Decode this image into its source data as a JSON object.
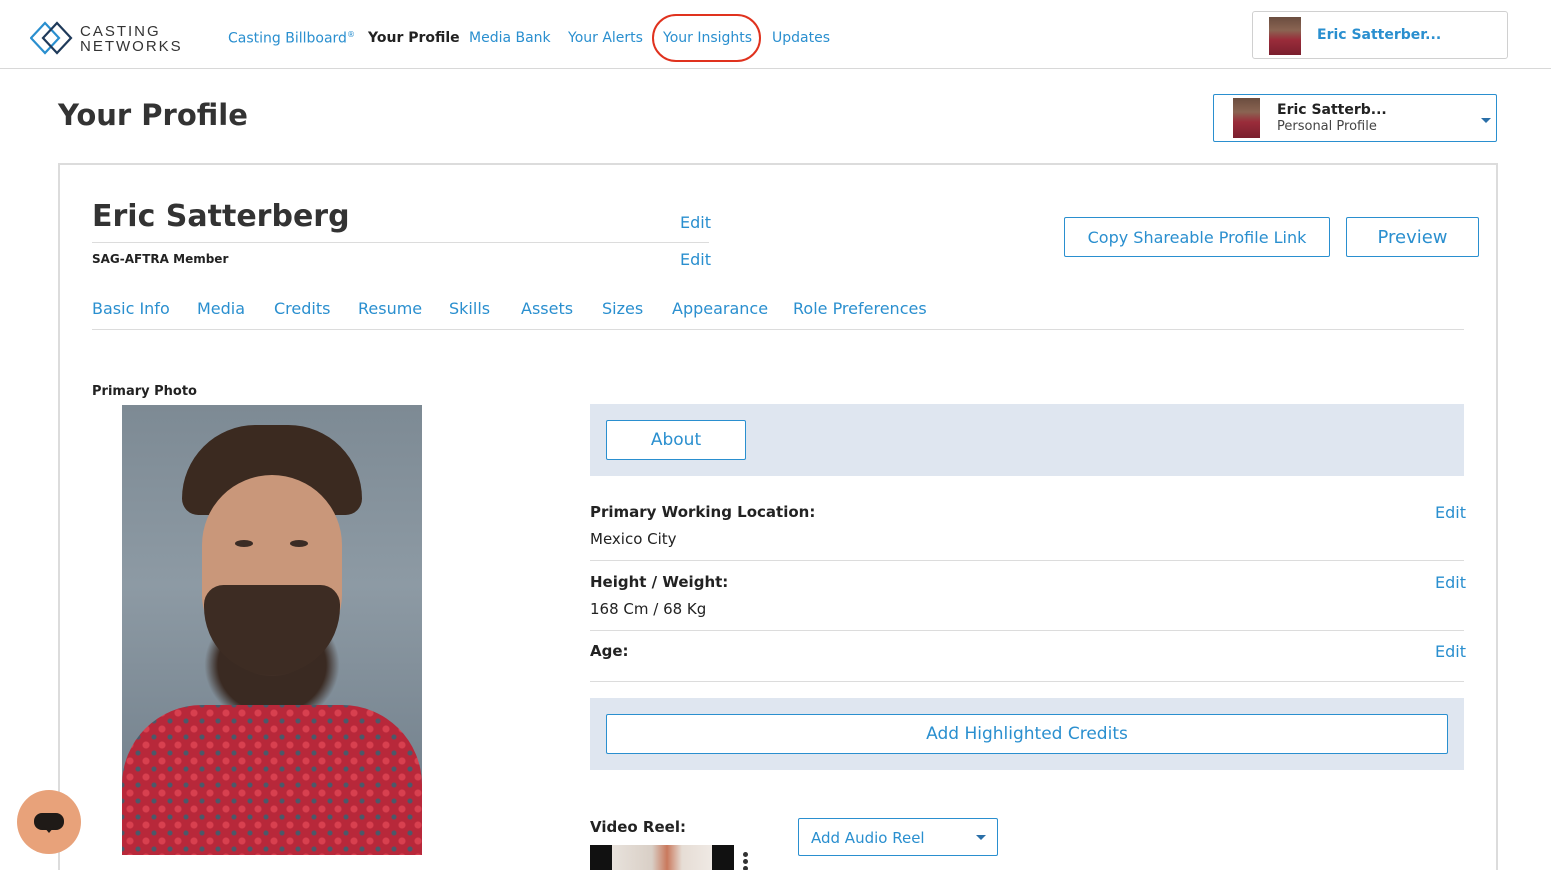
{
  "brand": {
    "line1": "CASTING",
    "line2": "NETWORKS"
  },
  "nav": {
    "items": [
      {
        "label": "Casting Billboard",
        "suffix": "®"
      },
      {
        "label": "Your Profile"
      },
      {
        "label": "Media Bank"
      },
      {
        "label": "Your Alerts"
      },
      {
        "label": "Your Insights"
      },
      {
        "label": "Updates"
      }
    ],
    "active": "Your Profile",
    "highlighted": "Your Insights"
  },
  "account": {
    "name": "Eric Satterber..."
  },
  "page": {
    "title": "Your Profile"
  },
  "profile_selector": {
    "name": "Eric Satterb...",
    "type": "Personal Profile"
  },
  "profile": {
    "full_name": "Eric Satterberg",
    "union": "SAG-AFTRA Member",
    "edit_label": "Edit"
  },
  "actions": {
    "copy_link": "Copy Shareable Profile Link",
    "preview": "Preview"
  },
  "tabs": [
    "Basic Info",
    "Media",
    "Credits",
    "Resume",
    "Skills",
    "Assets",
    "Sizes",
    "Appearance",
    "Role Preferences"
  ],
  "primary_photo": {
    "label": "Primary Photo"
  },
  "about": {
    "button": "About"
  },
  "fields": [
    {
      "label": "Primary Working Location:",
      "value": "Mexico City",
      "edit": "Edit"
    },
    {
      "label": "Height / Weight:",
      "value": "168 Cm / 68 Kg",
      "edit": "Edit"
    },
    {
      "label": "Age:",
      "value": "",
      "edit": "Edit"
    }
  ],
  "highlighted_credits": {
    "button": "Add Highlighted Credits"
  },
  "video_reel": {
    "label": "Video Reel:"
  },
  "audio_reel": {
    "button": "Add Audio Reel"
  },
  "colors": {
    "link": "#2a8fcf",
    "band": "#dfe6f0",
    "highlight_ring": "#e0321e",
    "chat": "#e8a27a"
  },
  "icons": {
    "logo": "casting-networks-logo",
    "chat": "chat-bubble-icon",
    "dropdown": "caret-down-icon",
    "more": "kebab-menu-icon"
  }
}
